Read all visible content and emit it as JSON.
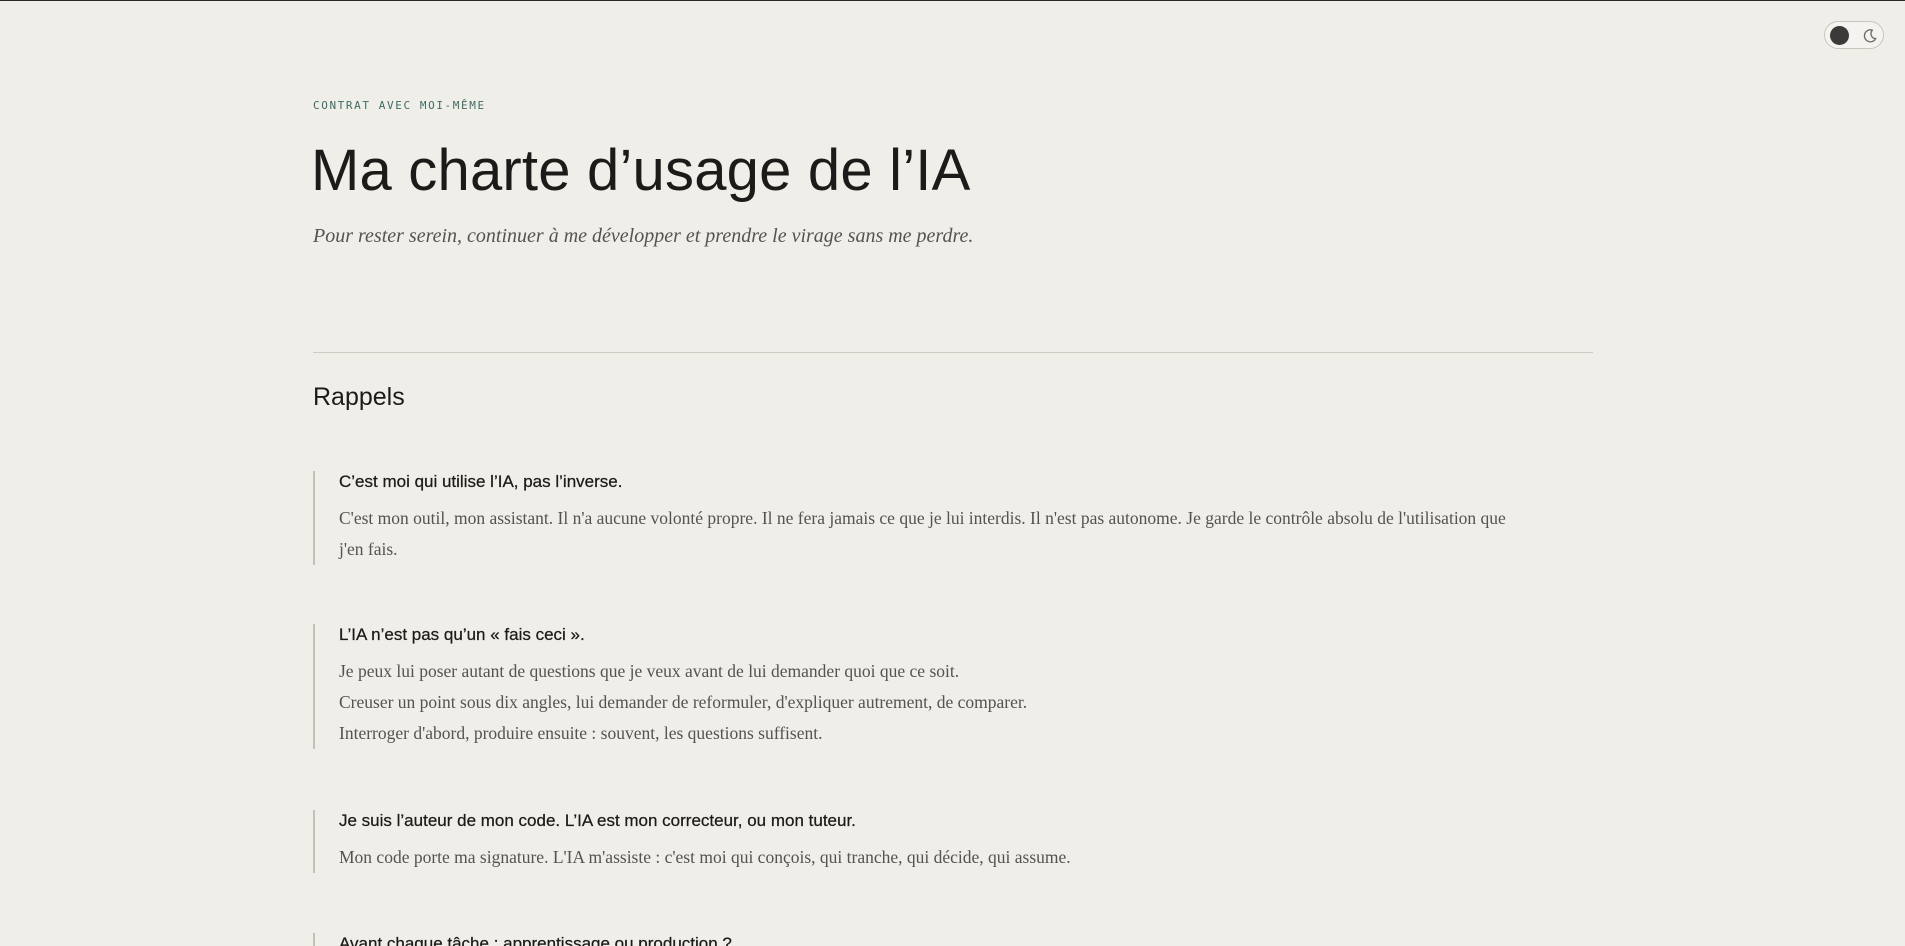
{
  "theme_toggle": {
    "state": "light",
    "knob_icon": "circle-knob",
    "icon": "moon-icon"
  },
  "header": {
    "eyebrow": "CONTRAT AVEC MOI-MÊME",
    "title": "Ma charte d’usage de l’IA",
    "subtitle": "Pour rester serein, continuer à me développer et prendre le virage sans me perdre."
  },
  "section": {
    "title": "Rappels",
    "rules": [
      {
        "title": "C’est moi qui utilise l’IA, pas l’inverse.",
        "lines": [
          "C'est mon outil, mon assistant. Il n'a aucune volonté propre. Il ne fera jamais ce que je lui interdis. Il n'est pas autonome. Je garde le contrôle absolu de l'utilisation que j'en fais."
        ]
      },
      {
        "title": "L’IA n’est pas qu’un « fais ceci ».",
        "lines": [
          "Je peux lui poser autant de questions que je veux avant de lui demander quoi que ce soit.",
          "Creuser un point sous dix angles, lui demander de reformuler, d'expliquer autrement, de comparer.",
          "Interroger d'abord, produire ensuite : souvent, les questions suffisent."
        ]
      },
      {
        "title": "Je suis l’auteur de mon code. L’IA est mon correcteur, ou mon tuteur.",
        "lines": [
          "Mon code porte ma signature. L'IA m'assiste : c'est moi qui conçois, qui tranche, qui décide, qui assume."
        ]
      },
      {
        "title": "Avant chaque tâche : apprentissage ou production ?",
        "lines": []
      }
    ]
  }
}
